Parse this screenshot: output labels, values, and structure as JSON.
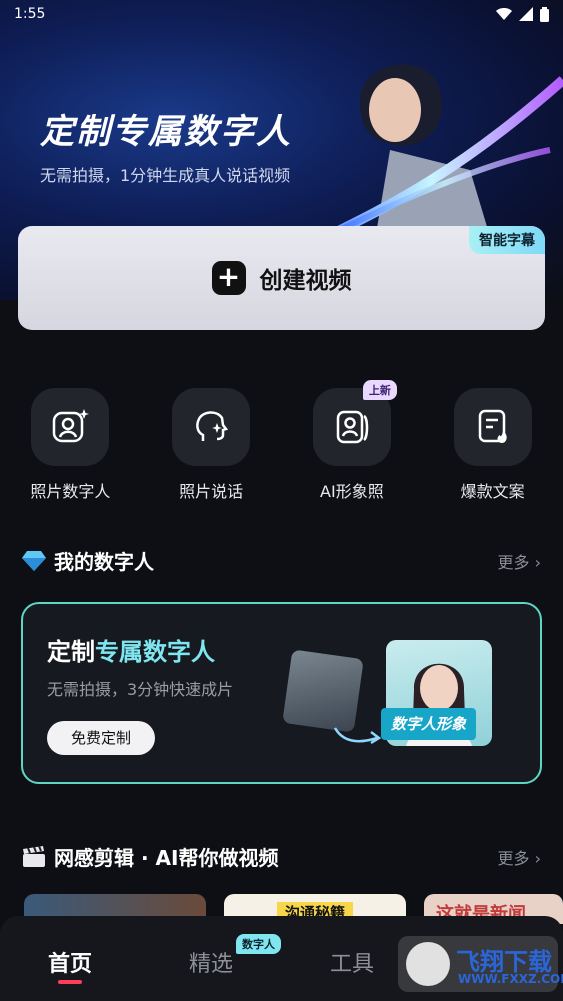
{
  "status_bar": {
    "time": "1:55"
  },
  "hero": {
    "title": "定制专属数字人",
    "subtitle": "无需拍摄，1分钟生成真人说话视频"
  },
  "create_card": {
    "label": "创建视频",
    "badge": "智能字幕"
  },
  "tools": [
    {
      "label": "照片数字人",
      "icon": "portrait-sparkle-icon"
    },
    {
      "label": "照片说话",
      "icon": "talking-head-icon"
    },
    {
      "label": "AI形象照",
      "icon": "portrait-card-icon",
      "badge": "上新"
    },
    {
      "label": "爆款文案",
      "icon": "document-fire-icon"
    }
  ],
  "my_digital_human": {
    "title": "我的数字人",
    "more": "更多",
    "card": {
      "title_prefix": "定制",
      "title_accent": "专属数字人",
      "subtitle": "无需拍摄，3分钟快速成片",
      "button": "免费定制",
      "tag": "数字人形象"
    }
  },
  "section_two": {
    "title": "网感剪辑 · AI帮你做视频",
    "more": "更多",
    "thumb_texts": [
      "沟通秘籍",
      "这就是新闻"
    ]
  },
  "tabbar": {
    "tabs": [
      "首页",
      "精选",
      "工具"
    ],
    "badge": "数字人"
  },
  "watermark": {
    "title": "飞翔下载",
    "url": "WWW.FXXZ.COM"
  },
  "colors": {
    "accent": "#7fe6f0",
    "card_border": "#5ed6c4",
    "active_indicator": "#ff3d5a"
  }
}
